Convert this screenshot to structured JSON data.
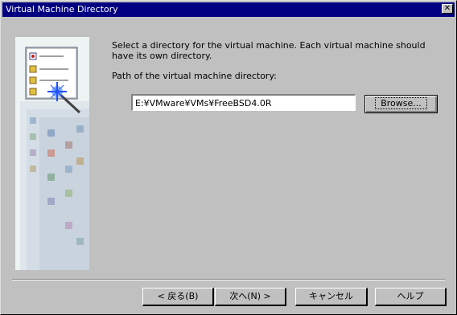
{
  "window": {
    "title": "Virtual Machine Directory",
    "close_glyph": "✕"
  },
  "main": {
    "description": "Select a directory for the virtual machine. Each virtual machine should have its own directory.",
    "path_label": "Path of the virtual machine directory:",
    "path_value": "E:¥VMware¥VMs¥FreeBSD4.0R",
    "browse_label": "Browse..."
  },
  "buttons": {
    "back": "< 戻る(B)",
    "next": "次へ(N) >",
    "cancel": "キャンセル",
    "help": "ヘルプ"
  },
  "icons": {
    "side_image": "wizard-desktop-icon"
  }
}
